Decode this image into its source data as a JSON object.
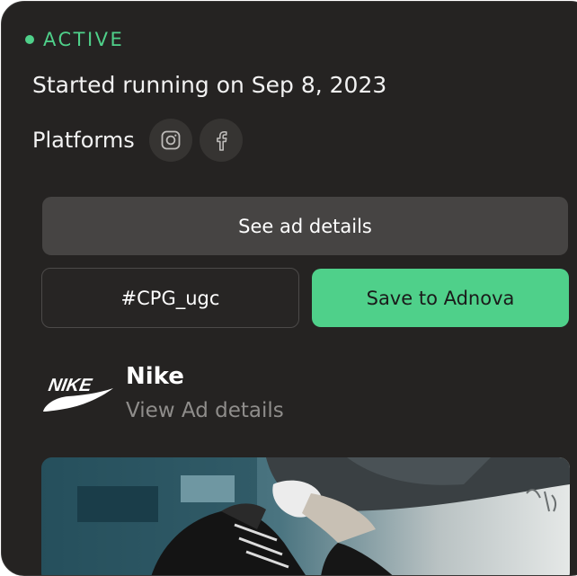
{
  "status": {
    "label": "ACTIVE",
    "color": "#4fd08a"
  },
  "started_text": "Started running on Sep 8, 2023",
  "platforms": {
    "label": "Platforms",
    "items": [
      {
        "icon": "instagram-icon"
      },
      {
        "icon": "facebook-icon"
      }
    ]
  },
  "actions": {
    "see_details_label": "See ad details",
    "tag_label": "#CPG_ugc",
    "save_label": "Save to Adnova"
  },
  "brand": {
    "name": "Nike",
    "logo_text": "NIKE",
    "view_link": "View Ad details"
  },
  "colors": {
    "card_background": "#252322",
    "accent": "#4fd08a",
    "secondary_button": "#464443"
  }
}
